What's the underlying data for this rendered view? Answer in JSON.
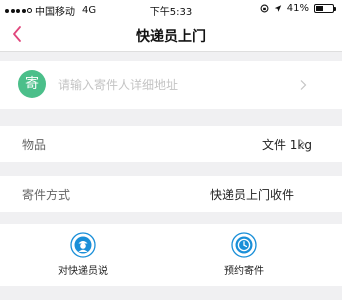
{
  "status_bar": {
    "carrier": "中国移动",
    "network": "4G",
    "time": "下午5:33",
    "battery_percent": "41%",
    "battery_level": 0.41
  },
  "nav": {
    "title": "快递员上门"
  },
  "address": {
    "badge": "寄",
    "placeholder": "请输入寄件人详细地址"
  },
  "item_row": {
    "label": "物品",
    "value": "文件 1kg"
  },
  "method_row": {
    "label": "寄件方式",
    "value": "快递员上门收件"
  },
  "actions": [
    {
      "label": "对快递员说",
      "icon": "courier-icon"
    },
    {
      "label": "预约寄件",
      "icon": "clock-icon"
    }
  ],
  "colors": {
    "accent": "#e0457b",
    "badge_green": "#4bbf8a",
    "action_blue": "#1a8fd8",
    "background": "#f0f0f2"
  }
}
